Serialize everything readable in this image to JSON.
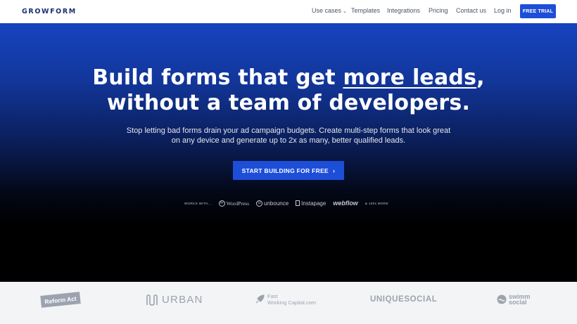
{
  "nav": {
    "logo": "GROWFORM",
    "links": [
      {
        "label": "Use cases",
        "caret": "⌄"
      },
      {
        "label": "Templates"
      },
      {
        "label": "Integrations"
      },
      {
        "label": "Pricing"
      },
      {
        "label": "Contact us"
      },
      {
        "label": "Log in"
      }
    ],
    "trial_label": "FREE TRIAL"
  },
  "hero": {
    "headline_part1": "Build forms that get ",
    "headline_highlight": "more leads",
    "headline_part2": ",",
    "headline_line2": "without a team of developers.",
    "subtitle_line1": "Stop letting bad forms drain your ad campaign budgets. Create multi-step forms that look great",
    "subtitle_line2": "on any device and generate up to 2x as many, better qualified leads.",
    "cta_label": "START BUILDING FOR FREE",
    "cta_chevron": "›"
  },
  "integrations": {
    "lead": "WORKS WITH...",
    "wordpress": "WordPress",
    "unbounce": "unbounce",
    "instapage": "Instapage",
    "webflow": "webflow",
    "more": "& 100s MORE"
  },
  "logos": {
    "reform": "Reform Act",
    "urban": "URBAN",
    "fast_line1": "Fast",
    "fast_line2": "Working Capital.com",
    "unique": "UNIQUESOCIAL",
    "swimm_line1": "swimm",
    "swimm_line2": "social"
  },
  "colors": {
    "brand_blue": "#1d4ed8",
    "logo_navy": "#1b2f6e"
  }
}
